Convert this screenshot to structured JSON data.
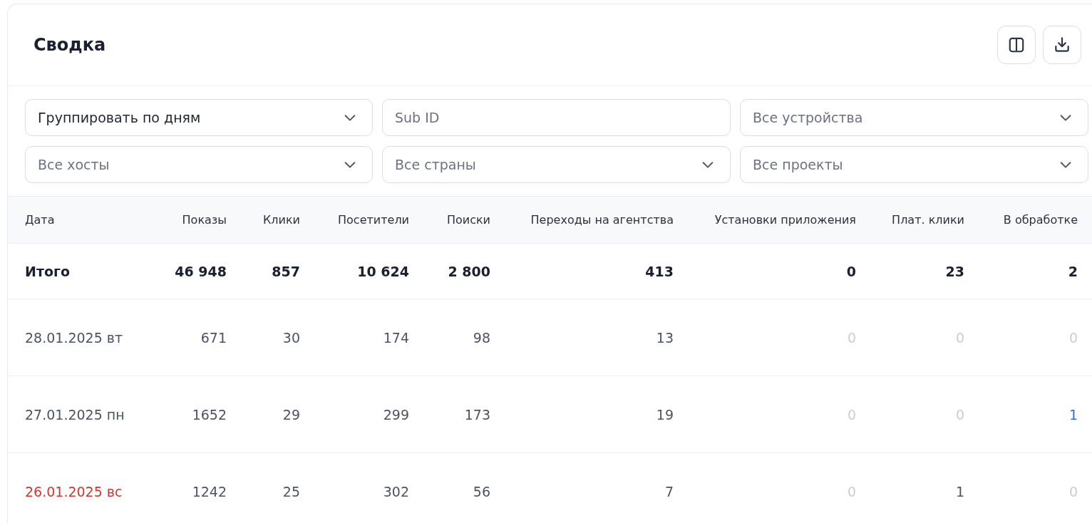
{
  "title": "Сводка",
  "filters": [
    {
      "kind": "select",
      "value": "Группировать по дням"
    },
    {
      "kind": "input",
      "placeholder": "Sub ID"
    },
    {
      "kind": "select",
      "placeholder": "Все устройства"
    },
    {
      "kind": "select",
      "placeholder": "Все хосты"
    },
    {
      "kind": "select",
      "placeholder": "Все страны"
    },
    {
      "kind": "select",
      "placeholder": "Все проекты"
    }
  ],
  "table": {
    "columns": [
      "Дата",
      "Показы",
      "Клики",
      "Посетители",
      "Поиски",
      "Переходы на агентства",
      "Установки приложения",
      "Плат. клики",
      "В обработке"
    ],
    "rows": [
      {
        "kind": "total",
        "weekend": false,
        "cells": [
          {
            "text": "Итого",
            "kind": "plain"
          },
          {
            "text": "46 948",
            "kind": "plain"
          },
          {
            "text": "857",
            "kind": "plain"
          },
          {
            "text": "10 624",
            "kind": "plain"
          },
          {
            "text": "2 800",
            "kind": "plain"
          },
          {
            "text": "413",
            "kind": "plain"
          },
          {
            "text": "0",
            "kind": "plain"
          },
          {
            "text": "23",
            "kind": "plain"
          },
          {
            "text": "2",
            "kind": "plain"
          }
        ]
      },
      {
        "kind": "day",
        "weekend": false,
        "cells": [
          {
            "text": "28.01.2025 вт",
            "kind": "plain"
          },
          {
            "text": "671",
            "kind": "plain"
          },
          {
            "text": "30",
            "kind": "plain"
          },
          {
            "text": "174",
            "kind": "plain"
          },
          {
            "text": "98",
            "kind": "plain"
          },
          {
            "text": "13",
            "kind": "plain"
          },
          {
            "text": "0",
            "kind": "muted"
          },
          {
            "text": "0",
            "kind": "muted"
          },
          {
            "text": "0",
            "kind": "muted"
          }
        ]
      },
      {
        "kind": "day",
        "weekend": false,
        "cells": [
          {
            "text": "27.01.2025 пн",
            "kind": "plain"
          },
          {
            "text": "1652",
            "kind": "plain"
          },
          {
            "text": "29",
            "kind": "plain"
          },
          {
            "text": "299",
            "kind": "plain"
          },
          {
            "text": "173",
            "kind": "plain"
          },
          {
            "text": "19",
            "kind": "plain"
          },
          {
            "text": "0",
            "kind": "muted"
          },
          {
            "text": "0",
            "kind": "muted"
          },
          {
            "text": "1",
            "kind": "link"
          }
        ]
      },
      {
        "kind": "day",
        "weekend": true,
        "cells": [
          {
            "text": "26.01.2025 вс",
            "kind": "plain"
          },
          {
            "text": "1242",
            "kind": "plain"
          },
          {
            "text": "25",
            "kind": "plain"
          },
          {
            "text": "302",
            "kind": "plain"
          },
          {
            "text": "56",
            "kind": "plain"
          },
          {
            "text": "7",
            "kind": "plain"
          },
          {
            "text": "0",
            "kind": "muted"
          },
          {
            "text": "1",
            "kind": "plain"
          },
          {
            "text": "0",
            "kind": "muted"
          }
        ]
      }
    ]
  }
}
